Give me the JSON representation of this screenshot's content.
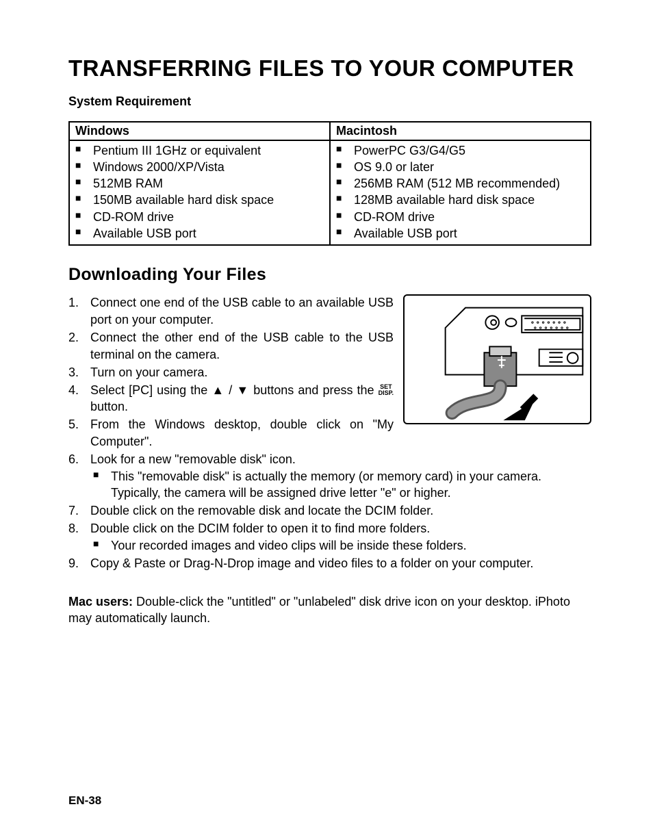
{
  "title": "TRANSFERRING FILES TO YOUR COMPUTER",
  "sysreq": {
    "heading": "System Requirement",
    "win_header": "Windows",
    "mac_header": "Macintosh",
    "win": [
      "Pentium III 1GHz or equivalent",
      "Windows 2000/XP/Vista",
      "512MB RAM",
      "150MB available hard disk space",
      "CD-ROM drive",
      "Available USB port"
    ],
    "mac": [
      "PowerPC G3/G4/G5",
      "OS 9.0 or later",
      "256MB RAM (512 MB recommended)",
      "128MB available hard disk space",
      "CD-ROM drive",
      "Available USB port"
    ]
  },
  "download": {
    "heading": "Downloading Your Files",
    "step1": "Connect one end of the USB cable to an available USB port on your computer.",
    "step2": "Connect the other end of the USB cable to the USB terminal on the camera.",
    "step3": "Turn on your camera.",
    "step4_a": "Select [PC] using the ▲ / ▼ buttons and press the ",
    "step4_b": " button.",
    "set_top": "SET",
    "set_bot": "DISP.",
    "step5": "From the Windows desktop, double click on \"My Computer\".",
    "step6": "Look for a new \"removable disk\" icon.",
    "step6_sub": "This \"removable disk\" is actually the memory (or memory card) in your camera. Typically, the camera will be assigned drive letter \"e\" or higher.",
    "step7": "Double click on the removable disk and locate the DCIM folder.",
    "step8": "Double click on the DCIM folder to open it to find more folders.",
    "step8_sub": "Your recorded images and video clips will be inside these folders.",
    "step9": "Copy & Paste or Drag-N-Drop image and video files to a folder on your computer."
  },
  "mac_users": {
    "label": "Mac users:",
    "text": " Double-click the \"untitled\" or \"unlabeled\" disk drive icon on your desktop. iPhoto may automatically launch."
  },
  "footer": "EN-38"
}
